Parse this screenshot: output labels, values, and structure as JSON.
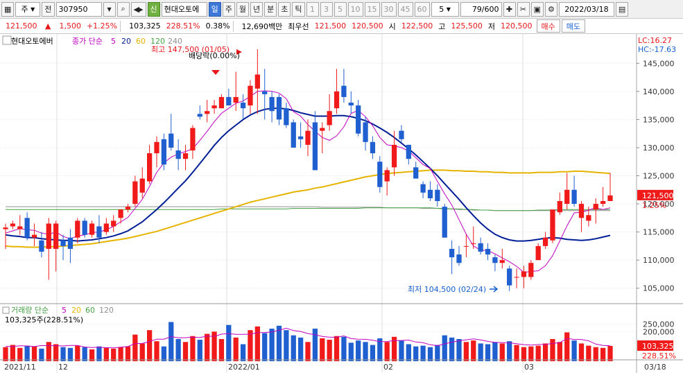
{
  "toolbar": {
    "market_code": "주",
    "prev_label": "전",
    "stock_code": "307950",
    "stock_name": "현대오토에",
    "new_badge": "신",
    "periods": [
      "일",
      "주",
      "월",
      "년",
      "분",
      "초",
      "틱"
    ],
    "active_period": "일",
    "intervals": [
      "1",
      "3",
      "5",
      "10",
      "15",
      "30",
      "45",
      "60"
    ],
    "interval_value": "5",
    "page_count": "79/600",
    "date": "2022/03/18"
  },
  "infobar": {
    "price": "121,500",
    "change": "1,500",
    "change_pct": "+1.25%",
    "volume": "103,325",
    "volume_ratio": "228.51%",
    "turnover": "0.38%",
    "amount": "12,690백만",
    "best_label": "최우선",
    "best_ask": "121,500",
    "best_bid": "120,500",
    "open_label": "시",
    "open": "122,500",
    "high_label": "고",
    "high": "125,500",
    "low_label": "저",
    "low": "120,500",
    "buy_label": "매수",
    "sell_label": "매도"
  },
  "legend": {
    "stock_name": "현대오토에버",
    "ma_prefix": "종가 단순",
    "ma_periods": [
      "5",
      "20",
      "60",
      "120",
      "240"
    ],
    "ma_colors": [
      "#c000c0",
      "#001e96",
      "#e6b400",
      "#44a044",
      "#909090"
    ],
    "lc": "LC:16.27",
    "hc": "HC:-17.63",
    "vol_prefix": "거래량 단순",
    "vol_periods": [
      "5",
      "20",
      "60",
      "120"
    ],
    "vol_value": "103,325주(228.51%)"
  },
  "annotations": {
    "high_label": "최고 147,500 (01/05)",
    "dividend_label": "배당락(0.00%)",
    "low_label": "최저 104,500 (02/24)"
  },
  "price_axis": {
    "ticks": [
      "145,000",
      "140,000",
      "135,000",
      "130,000",
      "125,000",
      "120,000",
      "115,000",
      "110,000",
      "105,000"
    ],
    "current_tag": "121,500",
    "pct_tag": "1.25%"
  },
  "volume_axis": {
    "ticks": [
      "250,000",
      "200,000"
    ],
    "current_tag": "103,325",
    "pct_tag": "228.51%"
  },
  "date_axis": {
    "labels": [
      "2021/11",
      "12",
      "2022/01",
      "02",
      "03"
    ],
    "end_label": "03/18"
  },
  "chart_data": {
    "type": "candlestick",
    "price_range": [
      102500,
      147500
    ],
    "volume_range": [
      0,
      300000
    ],
    "ohlc": [
      [
        115500,
        116500,
        112000,
        115800
      ],
      [
        116000,
        117000,
        115500,
        116500
      ],
      [
        115500,
        118000,
        114500,
        116000
      ],
      [
        117500,
        118500,
        113500,
        114000
      ],
      [
        114000,
        116500,
        112500,
        114500
      ],
      [
        113500,
        115000,
        110500,
        111500
      ],
      [
        112000,
        117500,
        106500,
        116500
      ],
      [
        112000,
        117000,
        108000,
        116500
      ],
      [
        113500,
        114500,
        110000,
        112500
      ],
      [
        114000,
        115500,
        109500,
        112000
      ],
      [
        114000,
        117500,
        113000,
        117000
      ],
      [
        117000,
        117500,
        114000,
        114500
      ],
      [
        114500,
        117000,
        114000,
        116500
      ],
      [
        116000,
        118000,
        113000,
        114000
      ],
      [
        115000,
        117500,
        114500,
        116500
      ],
      [
        116000,
        118000,
        115000,
        117000
      ],
      [
        117500,
        119000,
        116500,
        119000
      ],
      [
        119000,
        120000,
        118500,
        119500
      ],
      [
        120000,
        125000,
        119500,
        124000
      ],
      [
        122000,
        126500,
        121000,
        124500
      ],
      [
        124000,
        130500,
        123500,
        129000
      ],
      [
        129000,
        132000,
        126500,
        131000
      ],
      [
        131500,
        132500,
        126000,
        127000
      ],
      [
        132500,
        136000,
        129500,
        130000
      ],
      [
        129500,
        131500,
        126000,
        128000
      ],
      [
        128000,
        130500,
        126000,
        129000
      ],
      [
        129500,
        134000,
        128000,
        133500
      ],
      [
        136000,
        137500,
        135000,
        135500
      ],
      [
        136000,
        138500,
        134500,
        136500
      ],
      [
        137000,
        138500,
        136000,
        137500
      ],
      [
        137000,
        139500,
        137000,
        139000
      ],
      [
        139000,
        140500,
        137500,
        137500
      ],
      [
        138000,
        143500,
        136500,
        139000
      ],
      [
        138000,
        139500,
        135000,
        137000
      ],
      [
        137500,
        142000,
        136000,
        141000
      ],
      [
        140500,
        147500,
        136000,
        143000
      ],
      [
        140000,
        144000,
        135000,
        139500
      ],
      [
        139000,
        140000,
        134500,
        136500
      ],
      [
        139000,
        139500,
        134000,
        135000
      ],
      [
        137000,
        138000,
        133500,
        134000
      ],
      [
        134500,
        135000,
        130000,
        130000
      ],
      [
        132000,
        134500,
        130000,
        131500
      ],
      [
        130500,
        135000,
        128500,
        133000
      ],
      [
        134500,
        136500,
        126000,
        126000
      ],
      [
        133000,
        134500,
        129000,
        133500
      ],
      [
        134000,
        139500,
        133000,
        136500
      ],
      [
        137000,
        144000,
        136000,
        140000
      ],
      [
        141000,
        144000,
        138000,
        139000
      ],
      [
        138000,
        140000,
        136000,
        137500
      ],
      [
        137500,
        138500,
        132000,
        132500
      ],
      [
        134500,
        135500,
        129500,
        131000
      ],
      [
        131000,
        132000,
        128000,
        129000
      ],
      [
        127500,
        128500,
        122000,
        123000
      ],
      [
        124000,
        126500,
        121500,
        126000
      ],
      [
        126500,
        133000,
        125000,
        130500
      ],
      [
        133000,
        134000,
        131000,
        131500
      ],
      [
        130500,
        130500,
        127000,
        128000
      ],
      [
        126500,
        127500,
        124500,
        124500
      ],
      [
        123500,
        124000,
        121000,
        122000
      ],
      [
        122500,
        124000,
        120500,
        121000
      ],
      [
        122500,
        123500,
        119500,
        120500
      ],
      [
        119500,
        120000,
        114000,
        114000
      ],
      [
        112000,
        113500,
        107500,
        110500
      ],
      [
        111000,
        112500,
        109000,
        109500
      ],
      [
        112500,
        114500,
        110500,
        112500
      ],
      [
        113000,
        116000,
        112000,
        113000
      ],
      [
        113000,
        114000,
        111000,
        111500
      ],
      [
        112000,
        113000,
        110000,
        111000
      ],
      [
        110500,
        111000,
        108000,
        109500
      ],
      [
        109500,
        112000,
        108500,
        110000
      ],
      [
        108500,
        109000,
        104500,
        105500
      ],
      [
        107000,
        108500,
        105000,
        107000
      ],
      [
        107000,
        109000,
        105000,
        108000
      ],
      [
        107000,
        110000,
        106500,
        109500
      ],
      [
        110000,
        113000,
        110000,
        112500
      ],
      [
        112500,
        115000,
        112000,
        114000
      ],
      [
        113500,
        118500,
        113000,
        119000
      ],
      [
        118500,
        122000,
        118000,
        120500
      ],
      [
        120000,
        125500,
        119000,
        122500
      ],
      [
        122500,
        125000,
        119500,
        120000
      ],
      [
        117500,
        120500,
        115000,
        120000
      ],
      [
        117000,
        119500,
        116000,
        118000
      ],
      [
        119000,
        121000,
        116500,
        120000
      ],
      [
        120000,
        123000,
        119500,
        120500
      ],
      [
        120500,
        125500,
        120500,
        121500
      ]
    ],
    "volume": [
      95000,
      110000,
      90000,
      105000,
      100000,
      85000,
      130000,
      115000,
      95000,
      90000,
      105000,
      95000,
      80000,
      100000,
      90000,
      85000,
      95000,
      100000,
      180000,
      120000,
      210000,
      135000,
      100000,
      265000,
      150000,
      130000,
      170000,
      145000,
      185000,
      200000,
      150000,
      245000,
      160000,
      115000,
      210000,
      235000,
      190000,
      220000,
      240000,
      210000,
      175000,
      160000,
      130000,
      220000,
      155000,
      145000,
      170000,
      165000,
      125000,
      140000,
      130000,
      110000,
      155000,
      130000,
      165000,
      140000,
      115000,
      100000,
      105000,
      95000,
      110000,
      175000,
      160000,
      150000,
      130000,
      140000,
      120000,
      115000,
      130000,
      120000,
      135000,
      110000,
      95000,
      100000,
      105000,
      120000,
      150000,
      130000,
      195000,
      140000,
      120000,
      105000,
      95000,
      90000,
      103325
    ],
    "moving_averages": {
      "ma5": [
        114800,
        115200,
        115600,
        115400,
        115300,
        114800,
        114600,
        115000,
        114200,
        113800,
        114300,
        114500,
        114900,
        115000,
        115400,
        116000,
        116800,
        117600,
        119200,
        120800,
        123100,
        125600,
        127300,
        128300,
        128900,
        129300,
        129800,
        131300,
        132900,
        134600,
        136100,
        137000,
        137900,
        138300,
        139100,
        140000,
        140100,
        140000,
        139700,
        138700,
        136400,
        135600,
        134100,
        132900,
        131800,
        131300,
        132100,
        133700,
        136100,
        136600,
        135500,
        133900,
        131800,
        130500,
        130300,
        130000,
        129400,
        128200,
        127000,
        126300,
        124000,
        121800,
        119800,
        117200,
        114600,
        112500,
        111800,
        111700,
        111100,
        110400,
        109700,
        108900,
        107800,
        108000,
        108100,
        109000,
        110800,
        113400,
        116100,
        118400,
        118500,
        118900,
        119300,
        119000,
        119300
      ],
      "ma20": [
        114500,
        114300,
        114200,
        114000,
        114000,
        113800,
        113700,
        113600,
        113500,
        113500,
        113400,
        113500,
        113600,
        113800,
        114000,
        114300,
        114700,
        115200,
        116000,
        116800,
        117900,
        119000,
        120200,
        121500,
        122800,
        124100,
        125600,
        127200,
        128800,
        130400,
        131800,
        133000,
        134000,
        135000,
        135800,
        136400,
        136800,
        137000,
        137000,
        136900,
        136600,
        136200,
        135900,
        135600,
        135600,
        135600,
        135700,
        135700,
        135500,
        135200,
        134800,
        134200,
        133500,
        132700,
        131800,
        130800,
        129800,
        128700,
        127500,
        126300,
        125000,
        123600,
        122200,
        120800,
        119300,
        117900,
        116600,
        115500,
        114600,
        114000,
        113600,
        113400,
        113400,
        113500,
        113700,
        113900,
        114000,
        113900,
        113700,
        113600,
        113500,
        113600,
        113800,
        114100,
        114400
      ],
      "ma60": [
        112500,
        112400,
        112400,
        112300,
        112300,
        112300,
        112400,
        112400,
        112500,
        112600,
        112700,
        112800,
        112900,
        113100,
        113300,
        113500,
        113700,
        113900,
        114200,
        114500,
        114800,
        115100,
        115500,
        115900,
        116300,
        116700,
        117100,
        117500,
        117900,
        118300,
        118700,
        119100,
        119500,
        119900,
        120300,
        120600,
        120900,
        121200,
        121500,
        121800,
        122100,
        122300,
        122500,
        122800,
        123000,
        123300,
        123600,
        123900,
        124200,
        124500,
        124800,
        125000,
        125200,
        125400,
        125500,
        125600,
        125700,
        125800,
        125900,
        126000,
        126000,
        126000,
        125900,
        125900,
        125800,
        125800,
        125700,
        125700,
        125600,
        125600,
        125500,
        125500,
        125500,
        125500,
        125600,
        125600,
        125600,
        125700,
        125700,
        125800,
        125800,
        125700,
        125600,
        125500,
        125400
      ],
      "ma120": [
        119000,
        119000,
        119000,
        119000,
        119000,
        119000,
        119000,
        119000,
        119000,
        119000,
        119000,
        119000,
        119000,
        119000,
        119000,
        119000,
        119000,
        119000,
        119000,
        119000,
        119000,
        119000,
        119000,
        119000,
        119000,
        119000,
        119000,
        119000,
        119000,
        119000,
        119100,
        119100,
        119100,
        119100,
        119100,
        119100,
        119100,
        119100,
        119100,
        119100,
        119200,
        119200,
        119200,
        119200,
        119200,
        119200,
        119200,
        119200,
        119200,
        119200,
        119300,
        119300,
        119300,
        119300,
        119300,
        119300,
        119300,
        119300,
        119300,
        119300,
        119200,
        119200,
        119100,
        119100,
        119000,
        119000,
        118900,
        118900,
        118800,
        118800,
        118800,
        118800,
        118800,
        118800,
        118900,
        118900,
        118900,
        119000,
        119000,
        119000,
        119000,
        119000,
        119000,
        119000,
        119000
      ],
      "ma240": [
        119500,
        119500,
        119500,
        119500,
        119500,
        119500,
        119500,
        119500,
        119500,
        119500,
        119500,
        119500,
        119500,
        119500,
        119500,
        119500,
        119500,
        119500,
        119500,
        119500,
        119500,
        119500,
        119500,
        119500,
        119500,
        119500,
        119500,
        119500,
        119500,
        119500,
        119500,
        119500,
        119500,
        119500,
        119500,
        119500,
        119500,
        119500,
        119500,
        119500,
        119500,
        119500,
        119500,
        119500,
        119400,
        119400,
        119400,
        119400,
        119400,
        119400,
        119400,
        119400,
        119400,
        119300,
        119300,
        119300,
        119300,
        119300,
        119200,
        119200,
        119200,
        119100,
        119100,
        119000,
        119000,
        118900,
        118900,
        118900,
        118800,
        118800,
        118800,
        118800,
        118800,
        118800,
        118800,
        118800,
        118800,
        118800,
        118800,
        118800,
        118800,
        118800,
        118800,
        118800,
        118800
      ]
    },
    "volume_ma5": [
      100000,
      100000,
      104000,
      103000,
      99000,
      106000,
      105000,
      105000,
      103000,
      107000,
      107000,
      96000,
      93000,
      94000,
      92000,
      90000,
      95000,
      100000,
      119000,
      120000,
      133000,
      149000,
      149000,
      166000,
      159000,
      159000,
      163000,
      160000,
      170000,
      168000,
      183000,
      186000,
      182000,
      182000,
      183000,
      193000,
      194000,
      198000,
      209000,
      223000,
      207000,
      201000,
      187000,
      179000,
      168000,
      162000,
      162000,
      171000,
      153000,
      149000,
      148000,
      142000,
      132000,
      133000,
      140000,
      140000,
      143000,
      130000,
      125000,
      111000,
      105000,
      117000,
      129000,
      138000,
      145000,
      151000,
      144000,
      134000,
      127000,
      126000,
      124000,
      118000,
      112000,
      109000,
      113000,
      114000,
      120000,
      125000,
      154000,
      147000,
      147000,
      138000,
      116000,
      107000,
      104000
    ]
  }
}
